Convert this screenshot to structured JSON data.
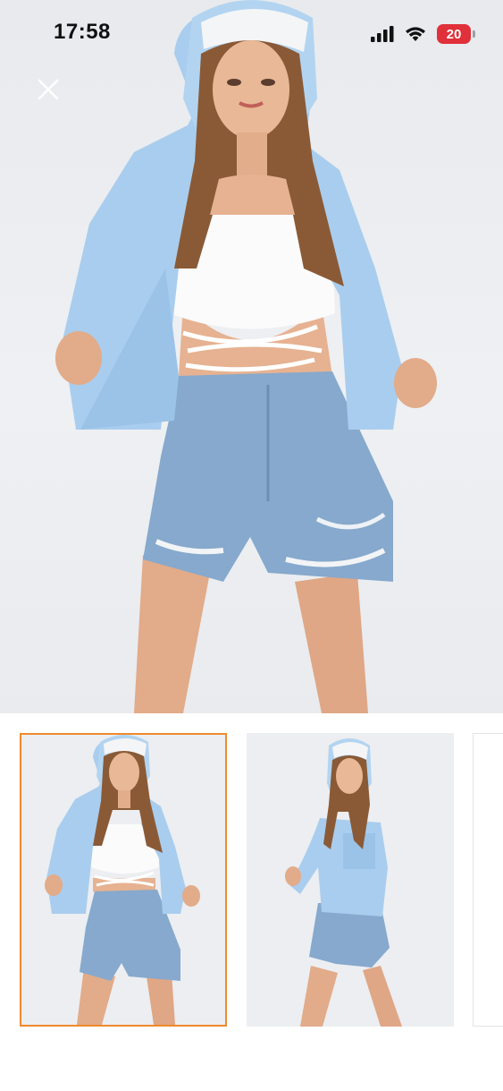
{
  "status_bar": {
    "time": "17:58",
    "battery_level": "20",
    "icons": [
      "cellular-signal-icon",
      "wifi-icon",
      "battery-icon"
    ]
  },
  "viewer": {
    "close_icon": "close-icon",
    "main_image": "product-photo-model-blue-jacket-denim-shorts"
  },
  "gallery": {
    "thumbnails": [
      {
        "image": "model-front-view",
        "selected": true
      },
      {
        "image": "model-side-view",
        "selected": false
      },
      {
        "image": "next-image-partial",
        "selected": false
      }
    ],
    "selected_border_color": "#f08a2e"
  },
  "colors": {
    "jacket": "#a9cdee",
    "denim": "#86a9cd",
    "skin": "#e4b08f",
    "hair": "#8a5a36",
    "battery_red": "#e0303a"
  }
}
